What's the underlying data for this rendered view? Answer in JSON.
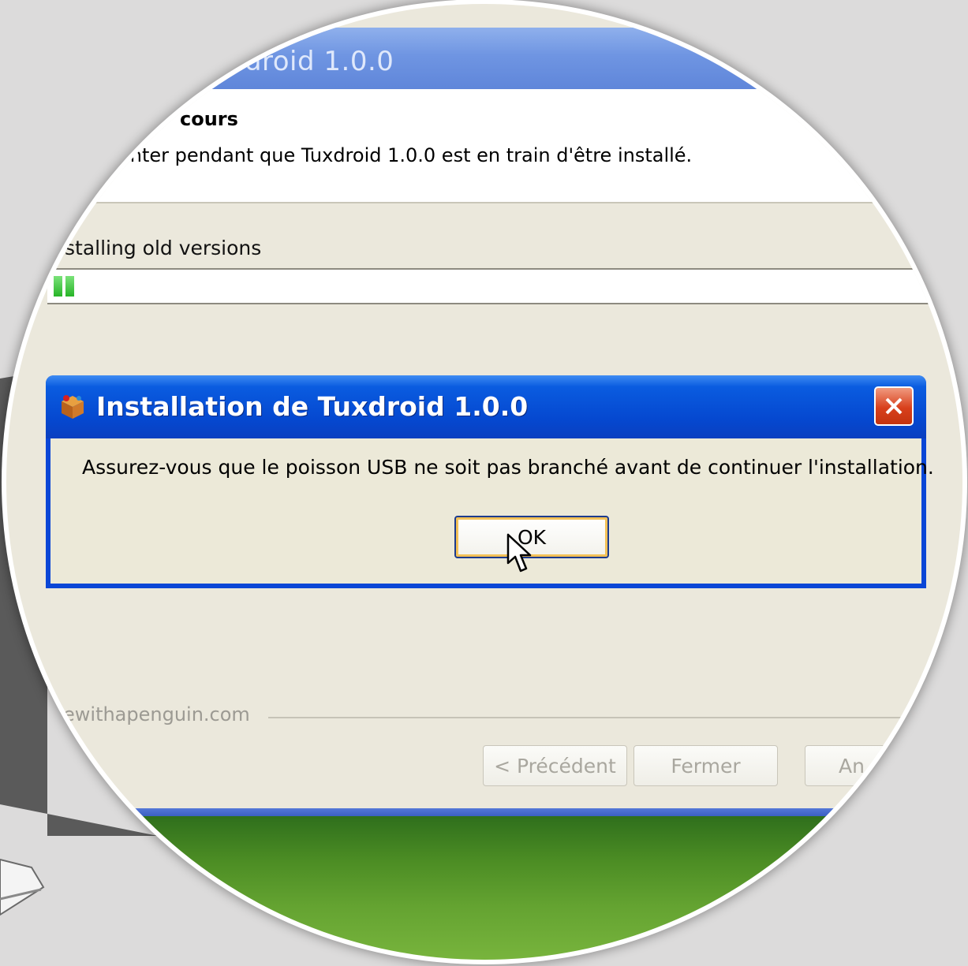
{
  "installer": {
    "title_partial": "ıdroid 1.0.0",
    "header_title_partial": "cours",
    "header_subtitle_partial": "enter pendant que Tuxdroid 1.0.0 est en train d'être installé.",
    "status_text_partial": "stalling old versions",
    "progress_fraction": 0.02,
    "brand_partial": "ewithapenguin.com",
    "buttons": {
      "back": "< Précédent",
      "close": "Fermer",
      "cancel_partial": "An"
    }
  },
  "dialog": {
    "title": "Installation de Tuxdroid 1.0.0",
    "message": "Assurez-vous que le poisson USB ne soit pas branché avant de continuer l'installation.",
    "ok_label": "OK",
    "icon": "installer-package-icon",
    "close_icon": "close-x-icon"
  },
  "colors": {
    "dialog_title_blue": "#0548d0",
    "close_red": "#d8401c",
    "progress_green": "#27b427",
    "dialog_bg": "#ece9d8"
  }
}
